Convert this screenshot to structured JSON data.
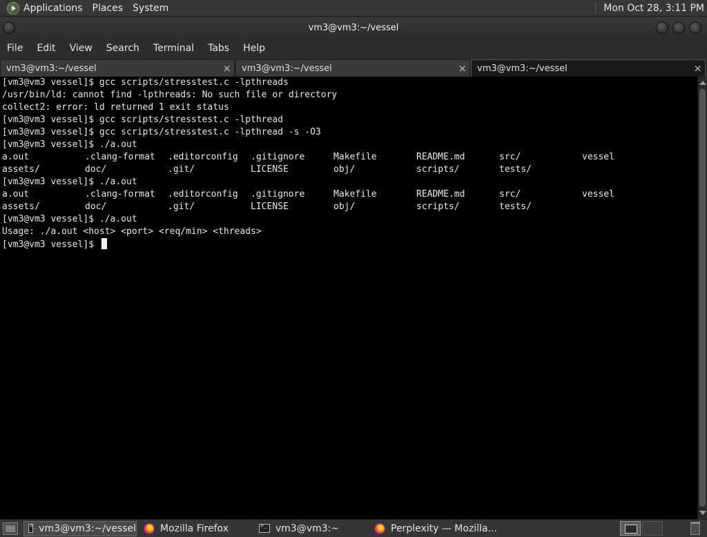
{
  "top_panel": {
    "menus": [
      "Applications",
      "Places",
      "System"
    ],
    "clock": "Mon Oct 28,  3:11 PM"
  },
  "window": {
    "title": "vm3@vm3:~/vessel"
  },
  "menubar": [
    "File",
    "Edit",
    "View",
    "Search",
    "Terminal",
    "Tabs",
    "Help"
  ],
  "tabs": [
    {
      "label": "vm3@vm3:~/vessel",
      "close": "×"
    },
    {
      "label": "vm3@vm3:~/vessel",
      "close": "×"
    },
    {
      "label": "vm3@vm3:~/vessel",
      "close": "×"
    }
  ],
  "terminal": {
    "lines": [
      "[vm3@vm3 vessel]$ gcc scripts/stresstest.c -lpthreads",
      "/usr/bin/ld: cannot find -lpthreads: No such file or directory",
      "collect2: error: ld returned 1 exit status",
      "[vm3@vm3 vessel]$ gcc scripts/stresstest.c -lpthread",
      "[vm3@vm3 vessel]$ gcc scripts/stresstest.c -lpthread -s -O3",
      "[vm3@vm3 vessel]$ ./a.out"
    ],
    "ls_row1": [
      "a.out",
      ".clang-format",
      ".editorconfig",
      ".gitignore",
      "Makefile",
      "README.md",
      "src/",
      "vessel"
    ],
    "ls_row2": [
      "assets/",
      "doc/",
      ".git/",
      "LICENSE",
      "obj/",
      "scripts/",
      "tests/",
      ""
    ],
    "line_run2": "[vm3@vm3 vessel]$ ./a.out",
    "line_run3": "[vm3@vm3 vessel]$ ./a.out",
    "usage": "Usage: ./a.out <host> <port> <req/min> <threads>",
    "prompt": "[vm3@vm3 vessel]$ "
  },
  "taskbar": {
    "items": [
      {
        "label": "vm3@vm3:~/vessel",
        "icon": "terminal-icon",
        "active": true
      },
      {
        "label": "Mozilla Firefox",
        "icon": "firefox-icon",
        "active": false
      },
      {
        "label": "vm3@vm3:~",
        "icon": "terminal-icon",
        "active": false
      },
      {
        "label": "Perplexity — Mozilla...",
        "icon": "firefox-icon",
        "active": false
      }
    ]
  }
}
